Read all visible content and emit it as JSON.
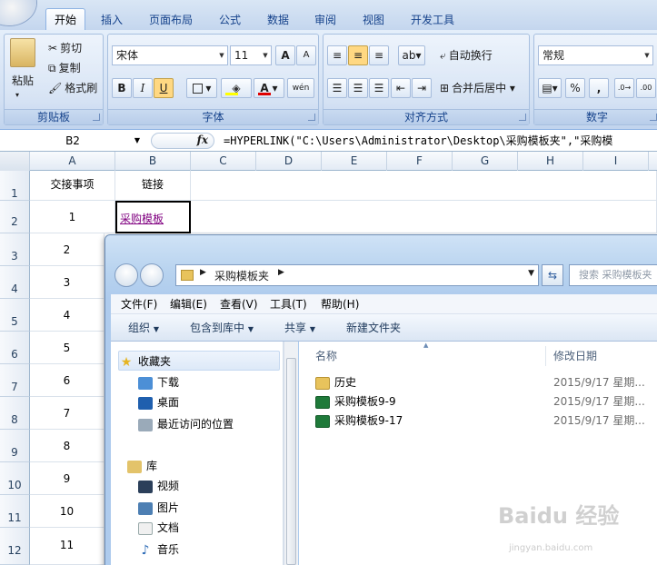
{
  "ribbon": {
    "tabs": [
      "开始",
      "插入",
      "页面布局",
      "公式",
      "数据",
      "审阅",
      "视图",
      "开发工具"
    ],
    "clipboard": {
      "label": "剪贴板",
      "paste": "粘贴",
      "cut": "剪切",
      "copy": "复制",
      "format_painter": "格式刷"
    },
    "font": {
      "label": "字体",
      "name": "宋体",
      "size": "11",
      "bold": "B",
      "italic": "I",
      "underline": "U",
      "grow": "A",
      "shrink": "A",
      "phonetic": "wén"
    },
    "alignment": {
      "label": "对齐方式",
      "wrap": "自动换行",
      "merge": "合并后居中"
    },
    "number": {
      "label": "数字",
      "format": "常规",
      "percent": "%",
      "comma": ","
    }
  },
  "formula_bar": {
    "name_box": "B2",
    "fx": "fx",
    "formula": "=HYPERLINK(\"C:\\Users\\Administrator\\Desktop\\采购模板夹\",\"采购模"
  },
  "sheet": {
    "columns": [
      "A",
      "B",
      "C",
      "D",
      "E",
      "F",
      "G",
      "H",
      "I"
    ],
    "rows": [
      "1",
      "2",
      "3",
      "4",
      "5",
      "6",
      "7",
      "8",
      "9",
      "10",
      "11",
      "12"
    ],
    "a1": "交接事项",
    "b1": "链接",
    "a_values": [
      "1",
      "2",
      "3",
      "4",
      "5",
      "6",
      "7",
      "8",
      "9",
      "10",
      "11"
    ],
    "b2": "采购模板"
  },
  "explorer": {
    "path": "采购模板夹",
    "search_placeholder": "搜索 采购模板夹",
    "menu": [
      "文件(F)",
      "编辑(E)",
      "查看(V)",
      "工具(T)",
      "帮助(H)"
    ],
    "commands": [
      "组织",
      "包含到库中",
      "共享",
      "新建文件夹"
    ],
    "favorites_title": "收藏夹",
    "favorites": [
      "下载",
      "桌面",
      "最近访问的位置"
    ],
    "library_title": "库",
    "libraries": [
      "视频",
      "图片",
      "文档",
      "音乐"
    ],
    "col_name": "名称",
    "col_date": "修改日期",
    "files": [
      {
        "name": "历史",
        "date": "2015/9/17 星期..."
      },
      {
        "name": "采购模板9-9",
        "date": "2015/9/17 星期..."
      },
      {
        "name": "采购模板9-17",
        "date": "2015/9/17 星期..."
      }
    ]
  },
  "watermark": {
    "brand": "Baidu 经验",
    "url": "jingyan.baidu.com"
  }
}
